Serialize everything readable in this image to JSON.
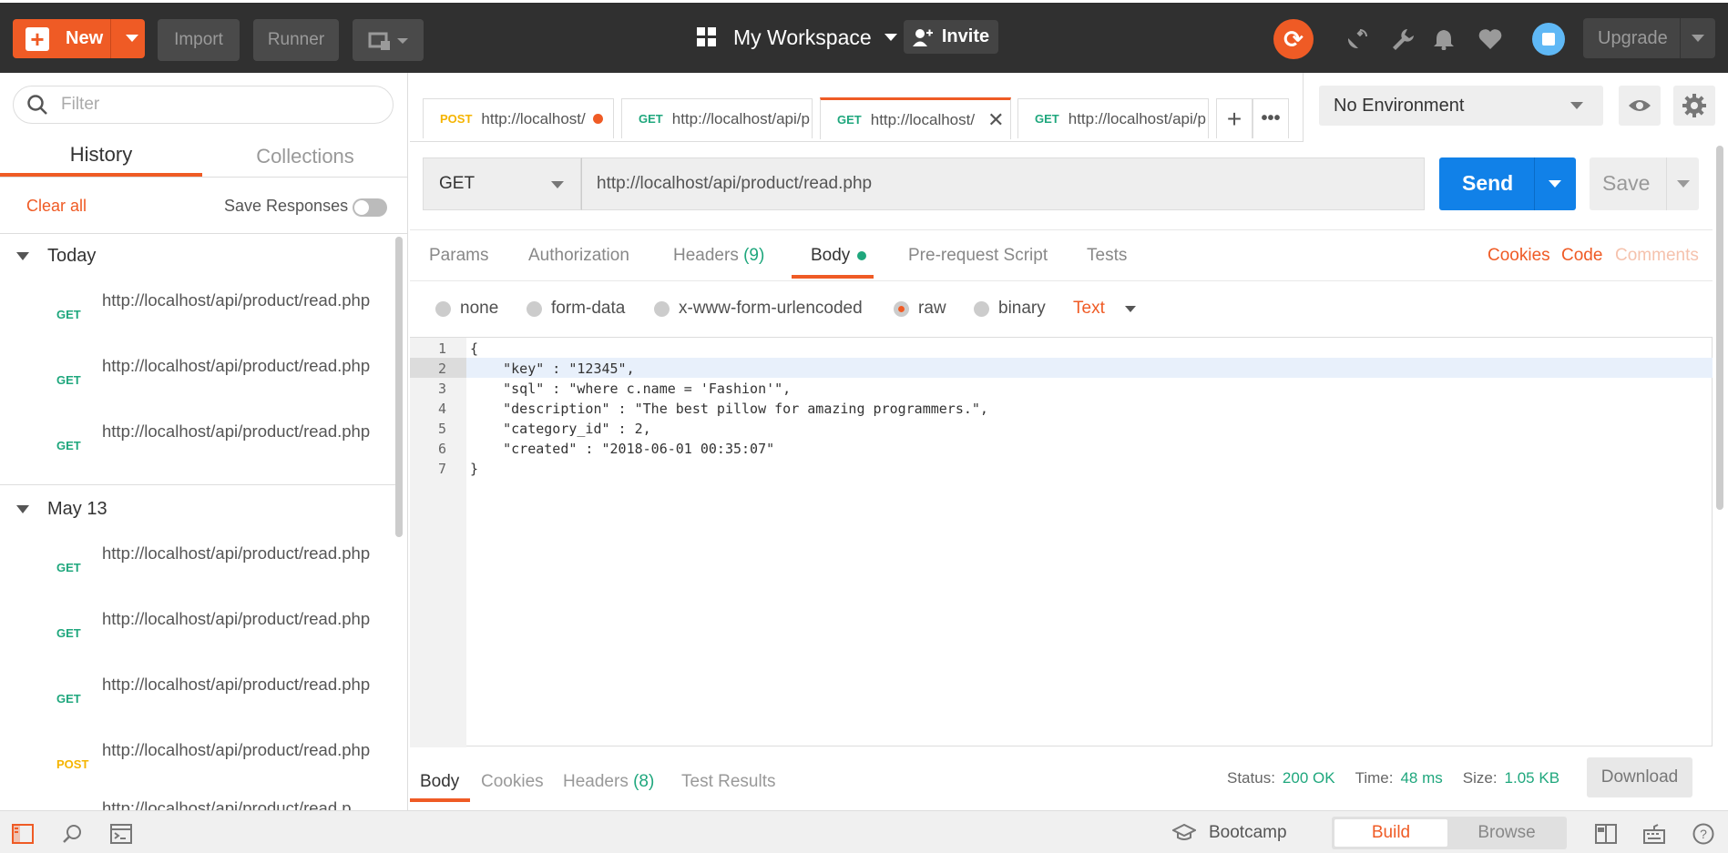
{
  "topbar": {
    "new_label": "New",
    "import_label": "Import",
    "runner_label": "Runner",
    "workspace_label": "My Workspace",
    "invite_label": "Invite",
    "upgrade_label": "Upgrade"
  },
  "sidebar": {
    "filter_placeholder": "Filter",
    "tabs": [
      "History",
      "Collections"
    ],
    "clear_all": "Clear all",
    "save_responses": "Save Responses",
    "groups": [
      {
        "title": "Today",
        "items": [
          {
            "method": "GET",
            "url": "http://localhost/api/product/read.php"
          },
          {
            "method": "GET",
            "url": "http://localhost/api/product/read.php"
          },
          {
            "method": "GET",
            "url": "http://localhost/api/product/read.php"
          }
        ]
      },
      {
        "title": "May 13",
        "items": [
          {
            "method": "GET",
            "url": "http://localhost/api/product/read.php"
          },
          {
            "method": "GET",
            "url": "http://localhost/api/product/read.php"
          },
          {
            "method": "GET",
            "url": "http://localhost/api/product/read.php"
          },
          {
            "method": "POST",
            "url": "http://localhost/api/product/read.php"
          },
          {
            "method": "",
            "url": "http://localhost/api/product/read.p"
          }
        ]
      }
    ]
  },
  "request_tabs": [
    {
      "method": "POST",
      "url": "http://localhost/",
      "unsaved": true
    },
    {
      "method": "GET",
      "url": "http://localhost/api/p"
    },
    {
      "method": "GET",
      "url": "http://localhost/",
      "active": true
    },
    {
      "method": "GET",
      "url": "http://localhost/api/p"
    }
  ],
  "environment": {
    "selected": "No Environment"
  },
  "request": {
    "method": "GET",
    "url": "http://localhost/api/product/read.php",
    "send_label": "Send",
    "save_label": "Save"
  },
  "req_tabs": {
    "params": "Params",
    "authorization": "Authorization",
    "headers": "Headers",
    "headers_count": "(9)",
    "body": "Body",
    "prerequest": "Pre-request Script",
    "tests": "Tests",
    "cookies": "Cookies",
    "code": "Code",
    "comments": "Comments"
  },
  "body_modes": {
    "none": "none",
    "form_data": "form-data",
    "urlencoded": "x-www-form-urlencoded",
    "raw": "raw",
    "binary": "binary",
    "text_type": "Text"
  },
  "editor": {
    "line_numbers": [
      "1",
      "2",
      "3",
      "4",
      "5",
      "6",
      "7"
    ],
    "lines": [
      "{",
      "    \"key\" : \"12345\",",
      "    \"sql\" : \"where c.name = 'Fashion'\",",
      "    \"description\" : \"The best pillow for amazing programmers.\",",
      "    \"category_id\" : 2,",
      "    \"created\" : \"2018-06-01 00:35:07\"",
      "}"
    ]
  },
  "response": {
    "tabs": [
      "Body",
      "Cookies",
      "Headers",
      "Test Results"
    ],
    "headers_count": "(8)",
    "status_label": "Status:",
    "status_value": "200 OK",
    "time_label": "Time:",
    "time_value": "48 ms",
    "size_label": "Size:",
    "size_value": "1.05 KB",
    "download_label": "Download"
  },
  "footer": {
    "bootcamp": "Bootcamp",
    "build": "Build",
    "browse": "Browse"
  },
  "colors": {
    "accent": "#ef5b25",
    "get": "#1fa77d",
    "post": "#f5b400",
    "send": "#1181e8"
  }
}
